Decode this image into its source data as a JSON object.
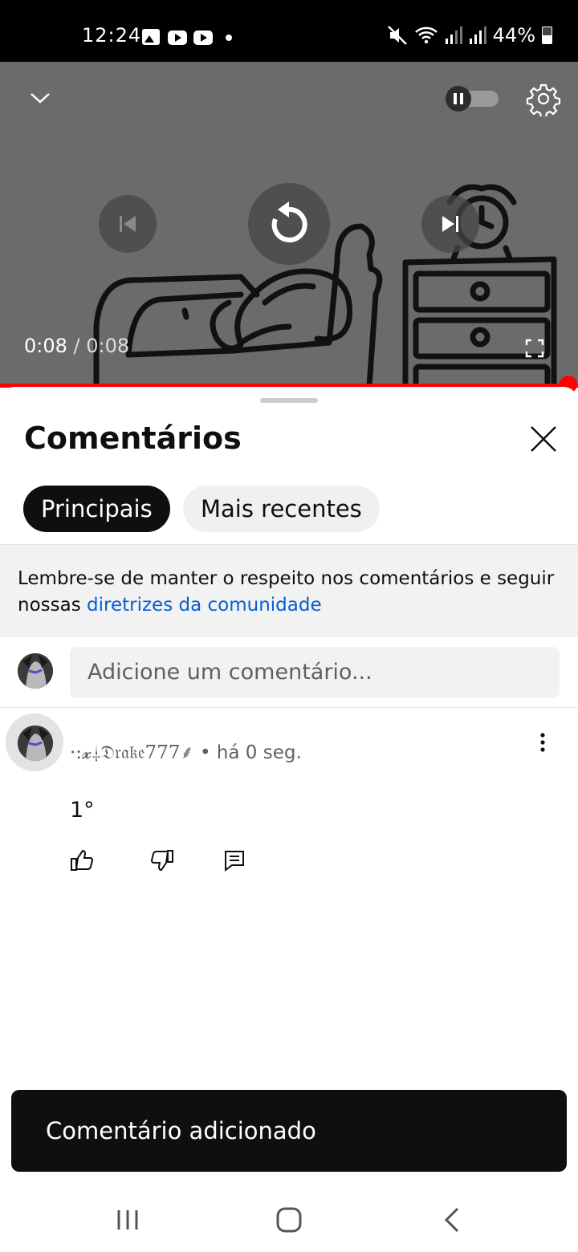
{
  "status_bar": {
    "time": "12:24",
    "battery": "44%"
  },
  "player": {
    "current_time": "0:08",
    "separator": "/",
    "duration": "0:08",
    "progress": 1.0
  },
  "comments": {
    "title": "Comentários",
    "chips": [
      {
        "label": "Principais",
        "selected": true
      },
      {
        "label": "Mais recentes",
        "selected": false
      }
    ],
    "guideline_text": "Lembre-se de manter o respeito nos comentários e seguir nossas ",
    "guideline_link": "diretrizes da comunidade",
    "input_placeholder": "Adicione um comentário...",
    "items": [
      {
        "author": "·:𝔁⸸𝔇𝔯𝔞𝔨𝔢777⸙",
        "time": "• há 0 seg.",
        "text": "1°"
      }
    ]
  },
  "toast": {
    "message": "Comentário adicionado"
  },
  "colors": {
    "accent": "#ff0000",
    "link": "#065fd4",
    "chip_selected": "#0f0f0f",
    "player_bg": "#6b6b6b"
  }
}
